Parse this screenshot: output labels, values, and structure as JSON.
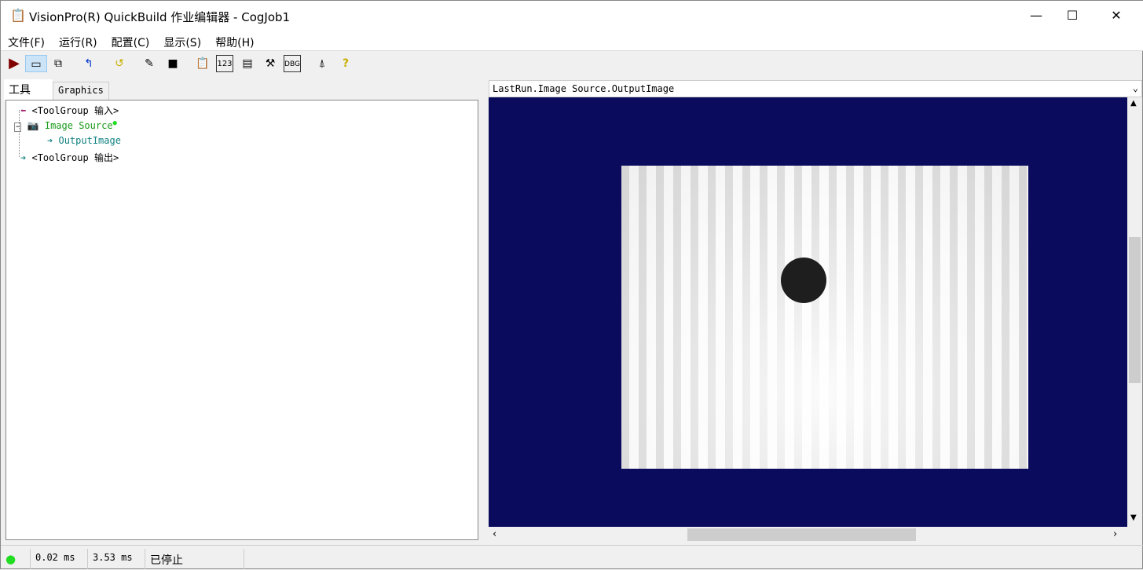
{
  "title": "VisionPro(R) QuickBuild 作业编辑器 - CogJob1",
  "menu": [
    "文件(F)",
    "运行(R)",
    "配置(C)",
    "显示(S)",
    "帮助(H)"
  ],
  "tabs": {
    "tools": "工具",
    "graphics": "Graphics"
  },
  "tree": {
    "input": "<ToolGroup 输入>",
    "source": "Image Source",
    "output_image": "OutputImage",
    "output": "<ToolGroup 输出>"
  },
  "viewer": {
    "selected": "LastRun.Image Source.OutputImage",
    "background": "#0b0b5e"
  },
  "status": {
    "t1": "0.02 ms",
    "t2": "3.53 ms",
    "state": "已停止"
  }
}
